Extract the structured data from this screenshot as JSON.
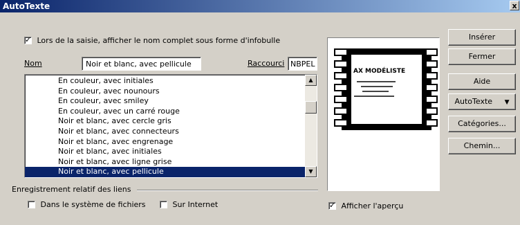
{
  "window": {
    "title": "AutoTexte",
    "close_glyph": "x"
  },
  "options": {
    "show_tooltip": {
      "label": "Lors de la saisie, afficher le nom complet sous forme d'infobulle",
      "checked": true
    }
  },
  "fields": {
    "name_label": "Nom",
    "name_value": "Noir et blanc, avec pellicule",
    "shortcut_label": "Raccourci",
    "shortcut_value": "NBPEL"
  },
  "list": {
    "items": [
      "En couleur, avec initiales",
      "En couleur, avec nounours",
      "En couleur, avec smiley",
      "En couleur, avec un carré rouge",
      "Noir et blanc, avec cercle gris",
      "Noir et blanc, avec connecteurs",
      "Noir et blanc, avec engrenage",
      "Noir et blanc, avec initiales",
      "Noir et blanc, avec ligne grise",
      "Noir et blanc, avec pellicule"
    ],
    "selected_index": 9,
    "scroll_up_icon": "▲",
    "scroll_down_icon": "▼"
  },
  "links": {
    "group_label": "Enregistrement relatif des liens",
    "filesystem": {
      "label": "Dans le système de fichiers",
      "checked": false
    },
    "internet": {
      "label": "Sur Internet",
      "checked": false
    }
  },
  "preview": {
    "title": "AX MODÉLISTE",
    "show_preview": {
      "label": "Afficher l'aperçu",
      "checked": true
    }
  },
  "buttons": {
    "insert": "Insérer",
    "close": "Fermer",
    "help": "Aide",
    "autotext": "AutoTexte",
    "autotext_arrow": "▼",
    "categories": "Catégories...",
    "path": "Chemin..."
  },
  "colors": {
    "title_bar": "#0a246a",
    "selection": "#0a246a",
    "face": "#d4d0c8"
  }
}
